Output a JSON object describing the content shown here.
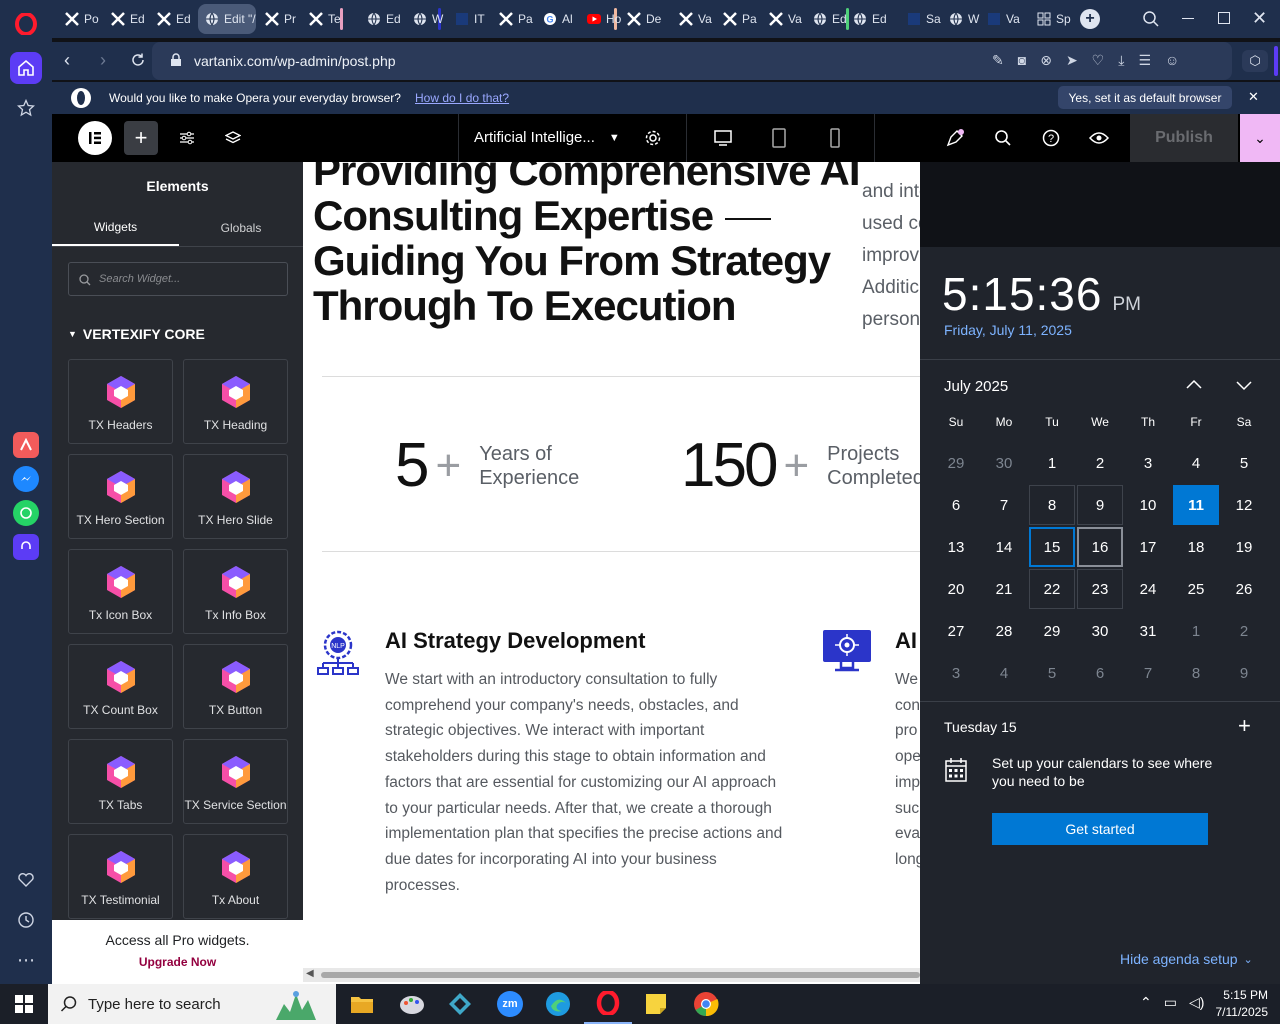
{
  "browser": {
    "tabs": [
      {
        "label": "Po",
        "icon": "x"
      },
      {
        "label": "Ed",
        "icon": "x"
      },
      {
        "label": "Ed",
        "icon": "x"
      },
      {
        "label": "Edit \"/",
        "icon": "globe",
        "active": true
      },
      {
        "label": "Pr",
        "icon": "x"
      },
      {
        "label": "Te",
        "icon": "x"
      },
      {
        "label": "Ed",
        "icon": "globe"
      },
      {
        "label": "W",
        "icon": "globe"
      },
      {
        "label": "IT",
        "icon": "square"
      },
      {
        "label": "Pa",
        "icon": "x"
      },
      {
        "label": "Al",
        "icon": "g"
      },
      {
        "label": "Ho",
        "icon": "yt"
      },
      {
        "label": "De",
        "icon": "x"
      },
      {
        "label": "Va",
        "icon": "x"
      },
      {
        "label": "Pa",
        "icon": "x"
      },
      {
        "label": "Va",
        "icon": "x"
      },
      {
        "label": "Ed",
        "icon": "globe"
      },
      {
        "label": "Ed",
        "icon": "globe"
      },
      {
        "label": "Sa",
        "icon": "square"
      },
      {
        "label": "W",
        "icon": "globe"
      },
      {
        "label": "Va",
        "icon": "square"
      },
      {
        "label": "Sp",
        "icon": "grid"
      }
    ],
    "url": "vartanix.com/wp-admin/post.php",
    "infobar": {
      "message": "Would you like to make Opera your everyday browser?",
      "link": "How do I do that?",
      "button": "Yes, set it as default browser"
    }
  },
  "elementor": {
    "page_select": "Artificial Intellige...",
    "publish": "Publish",
    "panel": {
      "title": "Elements",
      "tabs": [
        "Widgets",
        "Globals"
      ],
      "search_placeholder": "Search Widget...",
      "category": "VERTEXIFY CORE",
      "widgets": [
        "TX Headers",
        "TX Heading",
        "TX Hero Section",
        "TX Hero Slide",
        "Tx Icon Box",
        "Tx Info Box",
        "TX Count Box",
        "TX Button",
        "TX Tabs",
        "TX Service Section",
        "TX Testimonial",
        "Tx About"
      ],
      "promo_text": "Access all Pro widgets.",
      "promo_link": "Upgrade Now"
    }
  },
  "canvas": {
    "heading_lines": [
      "Providing Comprehensive AI",
      "Consulting Expertise",
      "Guiding You From Strategy",
      "Through To Execution"
    ],
    "right_lines": [
      "and internal teams in a number of ways when",
      "used correctly, such as increased productivity,",
      "improv",
      "Additic",
      "person"
    ],
    "stats": [
      {
        "value": "5",
        "plus": "+",
        "label1": "Years of",
        "label2": "Experience"
      },
      {
        "value": "150",
        "plus": "+",
        "label1": "Projects",
        "label2": "Completed"
      }
    ],
    "service1": {
      "icon_text": "NLP",
      "title": "AI Strategy Development",
      "body_lines": [
        "We start with an introductory consultation to fully",
        "comprehend your company's needs, obstacles, and",
        "strategic objectives. We interact with important",
        "stakeholders during this stage to obtain information and",
        "factors that are essential for customizing our AI approach",
        "to your particular needs. After that, we create a thorough",
        "implementation plan that specifies the precise actions and",
        "due dates for incorporating AI into your business",
        "processes."
      ]
    },
    "service2": {
      "title": "AI",
      "body_lines": [
        "We",
        "con",
        "pro",
        "ope",
        "imp",
        "suc",
        "eva",
        "long"
      ]
    }
  },
  "calendar": {
    "time": "5:15:36",
    "ampm": "PM",
    "date": "Friday, July 11, 2025",
    "month": "July 2025",
    "weekdays": [
      "Su",
      "Mo",
      "Tu",
      "We",
      "Th",
      "Fr",
      "Sa"
    ],
    "weeks": [
      [
        "29",
        "30",
        "1",
        "2",
        "3",
        "4",
        "5"
      ],
      [
        "6",
        "7",
        "8",
        "9",
        "10",
        "11",
        "12"
      ],
      [
        "13",
        "14",
        "15",
        "16",
        "17",
        "18",
        "19"
      ],
      [
        "20",
        "21",
        "22",
        "23",
        "24",
        "25",
        "26"
      ],
      [
        "27",
        "28",
        "29",
        "30",
        "31",
        "1",
        "2"
      ],
      [
        "3",
        "4",
        "5",
        "6",
        "7",
        "8",
        "9"
      ]
    ],
    "today": "11",
    "selected": "15",
    "agenda_day": "Tuesday 15",
    "agenda_text_1": "Set up your calendars to see where",
    "agenda_text_2": "you need to be",
    "get_started": "Get started",
    "hide_agenda": "Hide agenda setup"
  },
  "taskbar": {
    "search_placeholder": "Type here to search",
    "time": "5:15 PM",
    "date": "7/11/2025"
  },
  "colors": {
    "accent": "#0078d4",
    "opera_red": "#ff1b2d",
    "publish_pink": "#f0b8f5"
  }
}
